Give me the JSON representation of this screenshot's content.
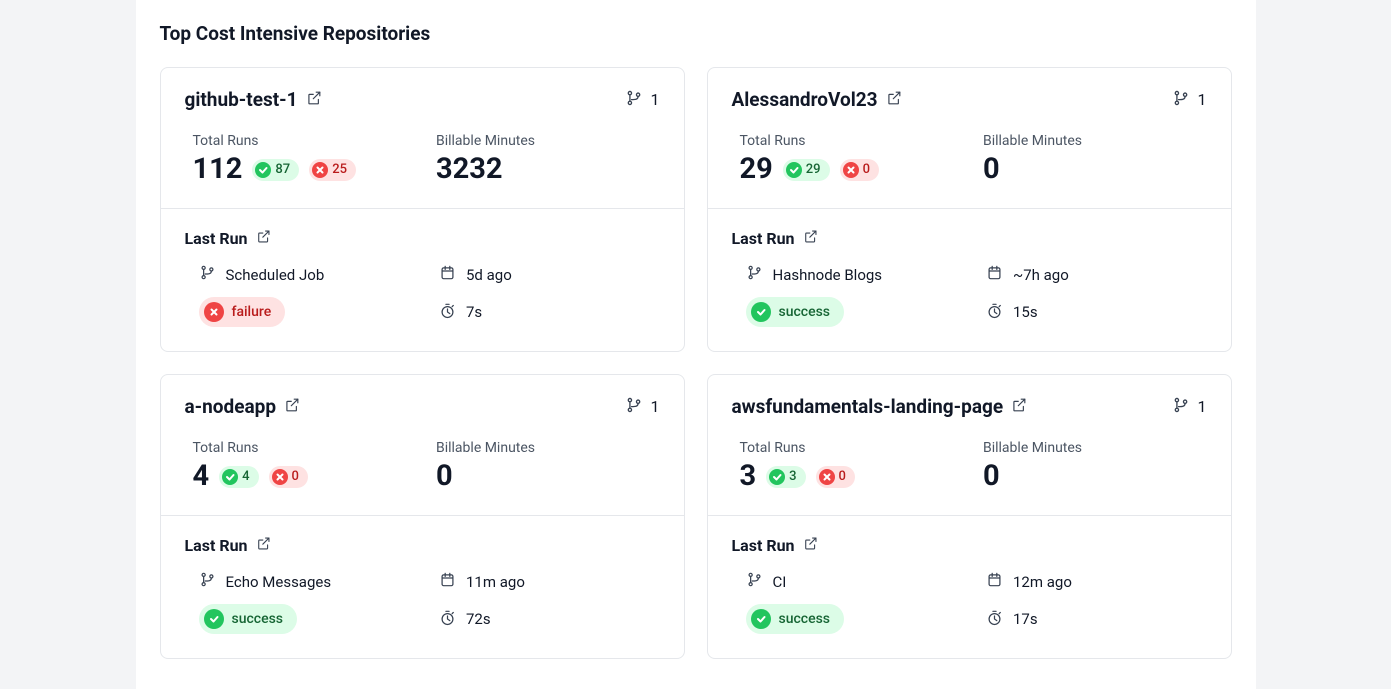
{
  "section_title": "Top Cost Intensive Repositories",
  "labels": {
    "total_runs": "Total Runs",
    "billable_minutes": "Billable Minutes",
    "last_run": "Last Run"
  },
  "repos": [
    {
      "name": "github-test-1",
      "branch_count": "1",
      "total_runs": "112",
      "success_runs": "87",
      "failure_runs": "25",
      "billable_minutes": "3232",
      "last_run": {
        "workflow": "Scheduled Job",
        "when": "5d ago",
        "status": "failure",
        "duration": "7s"
      }
    },
    {
      "name": "AlessandroVol23",
      "branch_count": "1",
      "total_runs": "29",
      "success_runs": "29",
      "failure_runs": "0",
      "billable_minutes": "0",
      "last_run": {
        "workflow": "Hashnode Blogs",
        "when": "~7h ago",
        "status": "success",
        "duration": "15s"
      }
    },
    {
      "name": "a-nodeapp",
      "branch_count": "1",
      "total_runs": "4",
      "success_runs": "4",
      "failure_runs": "0",
      "billable_minutes": "0",
      "last_run": {
        "workflow": "Echo Messages",
        "when": "11m ago",
        "status": "success",
        "duration": "72s"
      }
    },
    {
      "name": "awsfundamentals-landing-page",
      "branch_count": "1",
      "total_runs": "3",
      "success_runs": "3",
      "failure_runs": "0",
      "billable_minutes": "0",
      "last_run": {
        "workflow": "CI",
        "when": "12m ago",
        "status": "success",
        "duration": "17s"
      }
    }
  ]
}
